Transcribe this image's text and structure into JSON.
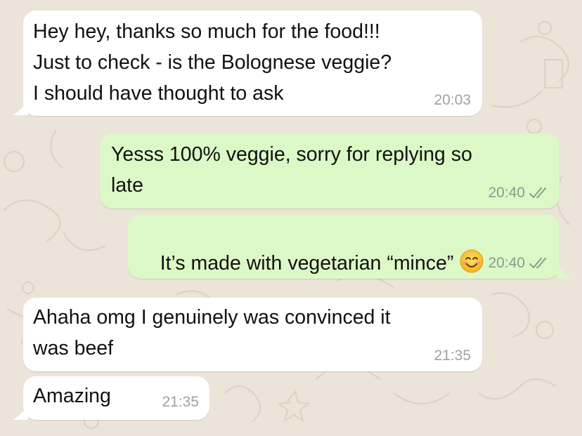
{
  "colors": {
    "background": "#ECE4D8",
    "incoming_bubble": "#FFFFFF",
    "outgoing_bubble": "#DCF8C6",
    "read_ticks": "#8D9A8C"
  },
  "messages": [
    {
      "direction": "incoming",
      "text": "Hey hey, thanks so much for the food!!!\nJust to check - is the Bolognese veggie?\nI should have thought to ask",
      "time": "20:03"
    },
    {
      "direction": "outgoing",
      "text": "Yesss 100% veggie, sorry for replying so\nlate",
      "time": "20:40",
      "status": "read-double-check-icon"
    },
    {
      "direction": "outgoing",
      "text": "It’s made with vegetarian “mince”",
      "emoji": "smiling-face-emoji",
      "time": "20:40",
      "status": "read-double-check-icon"
    },
    {
      "direction": "incoming",
      "text": "Ahaha omg I genuinely was convinced it\nwas beef",
      "time": "21:35"
    },
    {
      "direction": "incoming",
      "text": "Amazing",
      "time": "21:35"
    }
  ]
}
